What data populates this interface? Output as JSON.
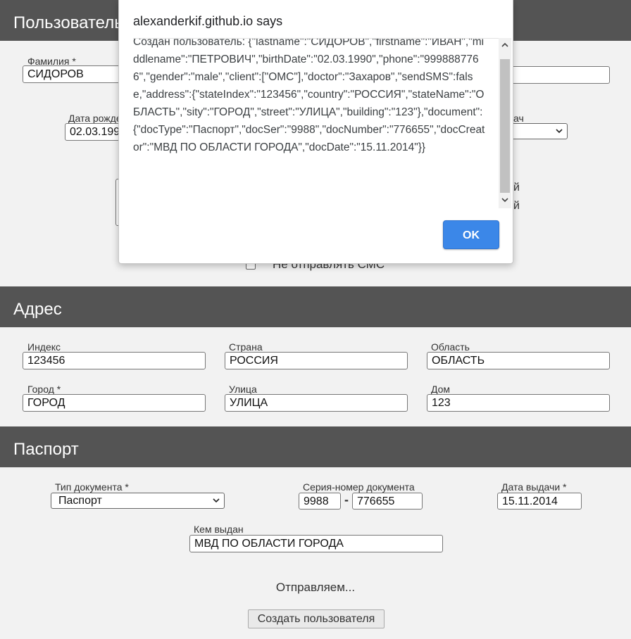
{
  "personal": {
    "header": "Пользователь",
    "lastname_label": "Фамилия *",
    "lastname_value": "СИДОРОВ",
    "birthdate_label": "Дата рожде",
    "birthdate_value": "02.03.199",
    "doctor_label_fragment": "ач",
    "sms_label": "Не отправлять СМС",
    "sms_checked": false
  },
  "address": {
    "header": "Адрес",
    "index_label": "Индекс",
    "index_value": "123456",
    "country_label": "Страна",
    "country_value": "РОССИЯ",
    "region_label": "Область",
    "region_value": "ОБЛАСТЬ",
    "city_label": "Город *",
    "city_value": "ГОРОД",
    "street_label": "Улица",
    "street_value": "УЛИЦА",
    "house_label": "Дом",
    "house_value": "123"
  },
  "passport": {
    "header": "Паспорт",
    "doctype_label": "Тип документа *",
    "doctype_value": "Паспорт",
    "sernum_label": "Серия-номер документа",
    "series_value": "9988",
    "dash": "-",
    "number_value": "776655",
    "issue_date_label": "Дата выдачи *",
    "issue_date_value": "15.11.2014",
    "issued_by_label": "Кем выдан",
    "issued_by_value": "МВД ПО ОБЛАСТИ ГОРОДА"
  },
  "footer": {
    "status_text": "Отправляем...",
    "submit_label": "Создать пользователя"
  },
  "dialog": {
    "title": "alexanderkif.github.io says",
    "message": "Создан пользователь: {\"lastname\":\"СИДОРОВ\",\"firstname\":\"ИВАН\",\"middlename\":\"ПЕТРОВИЧ\",\"birthDate\":\"02.03.1990\",\"phone\":\"9998887766\",\"gender\":\"male\",\"client\":[\"ОМС\"],\"doctor\":\"Захаров\",\"sendSMS\":false,\"address\":{\"stateIndex\":\"123456\",\"country\":\"РОССИЯ\",\"stateName\":\"ОБЛАСТЬ\",\"sity\":\"ГОРОД\",\"street\":\"УЛИЦА\",\"building\":\"123\"},\"document\":{\"docType\":\"Паспорт\",\"docSer\":\"9988\",\"docNumber\":\"776655\",\"docCreator\":\"МВД ПО ОБЛАСТИ ГОРОДА\",\"docDate\":\"15.11.2014\"}}",
    "ok_label": "OK"
  },
  "colors": {
    "header_bg": "#545454",
    "ok_button": "#3b87e8",
    "page_bg": "#f2f2f2"
  }
}
